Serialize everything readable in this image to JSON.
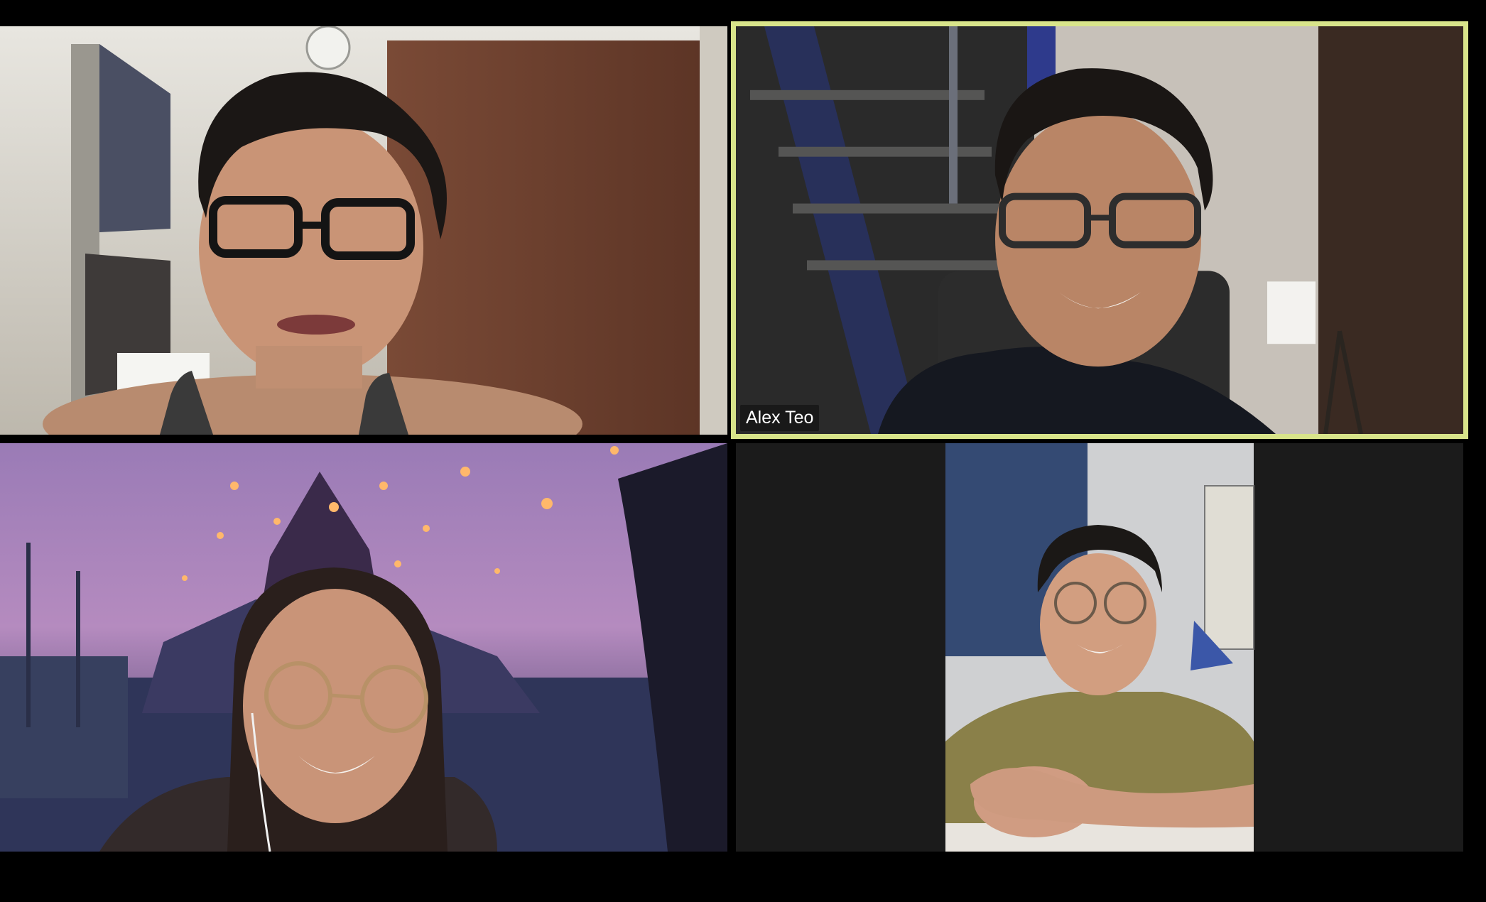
{
  "app": {
    "layout": "gallery-view-2x2",
    "active_speaker_highlight": "#d8e48a",
    "background": "#000000"
  },
  "participants": [
    {
      "name": "",
      "video": "on",
      "active_speaker": false
    },
    {
      "name": "Alex Teo",
      "video": "on",
      "active_speaker": true
    },
    {
      "name": "",
      "video": "on",
      "virtual_background": true,
      "active_speaker": false
    },
    {
      "name": "",
      "video": "on",
      "active_speaker": false
    }
  ]
}
